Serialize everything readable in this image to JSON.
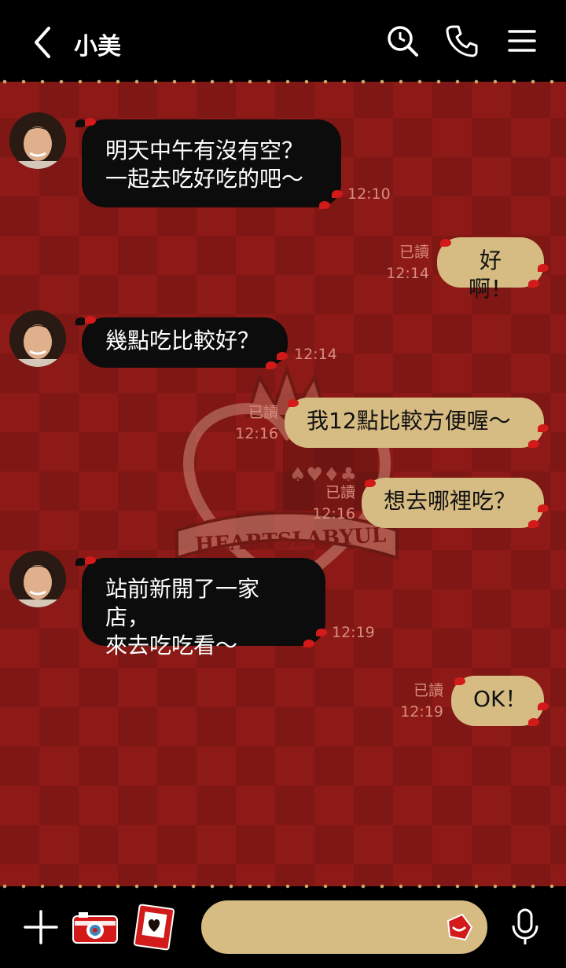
{
  "header": {
    "contact_name": "小美",
    "back_icon": "chevron-left-icon",
    "search_icon": "search-icon",
    "call_icon": "phone-icon",
    "menu_icon": "hamburger-menu-icon"
  },
  "theme": {
    "background": "#8d1a16",
    "incoming_bubble": "#0c0c0c",
    "outgoing_bubble": "#d6bb83",
    "meta_text": "#d98c7e",
    "watermark_text": "HEARTSLABYUL"
  },
  "messages": [
    {
      "side": "in",
      "text": "明天中午有沒有空？\n一起去吃好吃的吧～",
      "time": "12:10"
    },
    {
      "side": "out",
      "text": "好啊！",
      "read": "已讀",
      "time": "12:14"
    },
    {
      "side": "in",
      "text": "幾點吃比較好？",
      "time": "12:14"
    },
    {
      "side": "out",
      "text": "我12點比較方便喔～",
      "read": "已讀",
      "time": "12:16"
    },
    {
      "side": "out",
      "text": "想去哪裡吃？",
      "read": "已讀",
      "time": "12:16"
    },
    {
      "side": "in",
      "text": "站前新開了一家店，\n來去吃吃看～",
      "time": "12:19"
    },
    {
      "side": "out",
      "text": "OK！",
      "read": "已讀",
      "time": "12:19"
    }
  ],
  "footer": {
    "plus_icon": "plus-icon",
    "camera_icon": "camera-icon",
    "photo_icon": "photo-card-icon",
    "input_value": "",
    "sticker_icon": "sticker-icon",
    "mic_icon": "microphone-icon"
  }
}
